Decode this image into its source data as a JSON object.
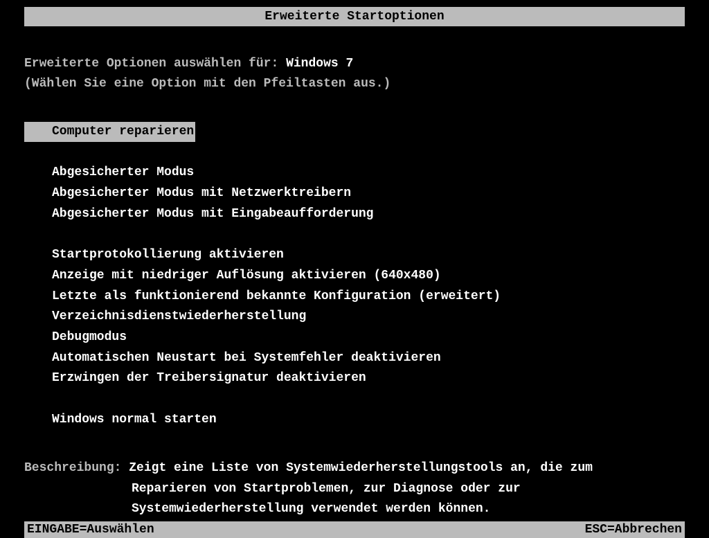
{
  "title": "Erweiterte Startoptionen",
  "prompt_prefix": "Erweiterte Optionen auswählen für: ",
  "os_name": "Windows 7",
  "instruction": "(Wählen Sie eine Option mit den Pfeiltasten aus.)",
  "menu": {
    "selected_index": 0,
    "group1": [
      "Computer reparieren"
    ],
    "group2": [
      "Abgesicherter Modus",
      "Abgesicherter Modus mit Netzwerktreibern",
      "Abgesicherter Modus mit Eingabeaufforderung"
    ],
    "group3": [
      "Startprotokollierung aktivieren",
      "Anzeige mit niedriger Auflösung aktivieren (640x480)",
      "Letzte als funktionierend bekannte Konfiguration (erweitert)",
      "Verzeichnisdienstwiederherstellung",
      "Debugmodus",
      "Automatischen Neustart bei Systemfehler deaktivieren",
      "Erzwingen der Treibersignatur deaktivieren"
    ],
    "group4": [
      "Windows normal starten"
    ]
  },
  "description": {
    "label": "Beschreibung: ",
    "line1": "Zeigt eine Liste von Systemwiederherstellungstools an, die zum",
    "line2": "Reparieren von Startproblemen, zur Diagnose oder zur",
    "line3": "Systemwiederherstellung verwendet werden können."
  },
  "footer": {
    "left": "EINGABE=Auswählen",
    "right": "ESC=Abbrechen"
  }
}
